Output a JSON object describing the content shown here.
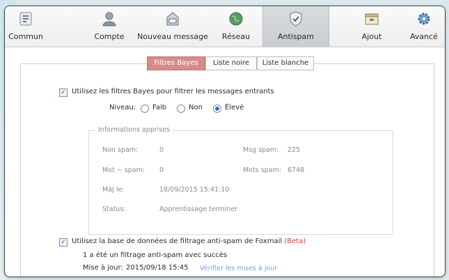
{
  "toolbar": {
    "items": [
      {
        "label": "Commun",
        "icon": "general-icon"
      },
      {
        "label": "Compte",
        "icon": "account-icon"
      },
      {
        "label": "Nouveau message",
        "icon": "compose-icon"
      },
      {
        "label": "Réseau",
        "icon": "network-icon"
      },
      {
        "label": "Antispam",
        "icon": "shield-icon"
      },
      {
        "label": "Ajout",
        "icon": "addon-icon"
      },
      {
        "label": "Avancé",
        "icon": "gear-icon"
      }
    ],
    "active": "Antispam"
  },
  "tabs": [
    "Filtres Bayes",
    "Liste noire",
    "Liste blanche"
  ],
  "bayes": {
    "checkbox_label": "Utilisez les filtres Bayes pour filtrer les messages entrants",
    "level_label": "Niveau:",
    "levels": [
      "Faib",
      "Non",
      "Élevé"
    ],
    "selected_level": "Élevé"
  },
  "learned": {
    "title": "Informations apprises",
    "non_spam_label": "Non spam:",
    "non_spam_value": "0",
    "msg_spam_label": "Msg spam:",
    "msg_spam_value": "225",
    "mot_spam_label": "Mot ~ spam:",
    "mot_spam_value": "0",
    "mots_spam_label": "Mots spam:",
    "mots_spam_value": "6748",
    "maj_label": "MàJ le:",
    "maj_value": "18/09/2015 15:41:10",
    "status_label": "Status:",
    "status_value": "Apprentissage terminer"
  },
  "foxmail": {
    "checkbox_label": "Utilisez la base de données de filtrage anti-spam de Foxmail",
    "beta": "(Beta)",
    "result": "1 a été un filtrage anti-spam avec succès",
    "update_label": "Mise à jour:",
    "update_value": "2015/09/18 15:45",
    "check_link": "Vérifier les mises à jour"
  },
  "colors": {
    "active_tab": "#d98b8b",
    "beta": "#d23c3c",
    "link": "#7aa0d6"
  }
}
